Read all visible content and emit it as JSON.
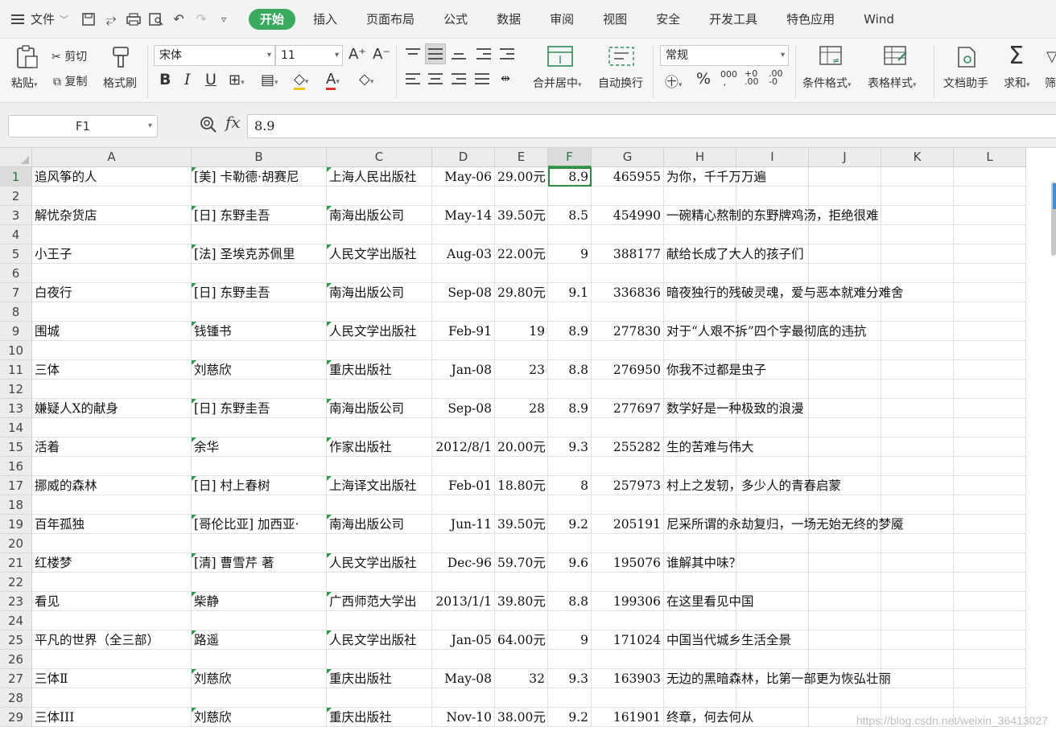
{
  "topbar": {
    "file_menu": "文件",
    "tabs": [
      {
        "label": "开始",
        "active": true
      },
      {
        "label": "插入"
      },
      {
        "label": "页面布局"
      },
      {
        "label": "公式"
      },
      {
        "label": "数据"
      },
      {
        "label": "审阅"
      },
      {
        "label": "视图"
      },
      {
        "label": "安全"
      },
      {
        "label": "开发工具"
      },
      {
        "label": "特色应用"
      },
      {
        "label": "Wind"
      }
    ],
    "accent": "#3aaa5e"
  },
  "ribbon": {
    "paste": "粘贴",
    "cut": "剪切",
    "copy": "复制",
    "format_painter": "格式刷",
    "font_name": "宋体",
    "font_size": "11",
    "bold": "B",
    "italic": "I",
    "underline": "U",
    "merge_center": "合并居中",
    "wrap_text": "自动换行",
    "number_format": "常规",
    "conditional_format": "条件格式",
    "table_style": "表格样式",
    "doc_assistant": "文档助手",
    "sum": "求和",
    "filter": "筛"
  },
  "formula_bar": {
    "name_box": "F1",
    "fx": "fx",
    "value": "8.9"
  },
  "columns": [
    "A",
    "B",
    "C",
    "D",
    "E",
    "F",
    "G",
    "H",
    "I",
    "J",
    "K",
    "L"
  ],
  "selected_cell": "F1",
  "rows": [
    {
      "n": "1",
      "A": "追风筝的人",
      "B": "[美] 卡勒德·胡赛尼",
      "C": "上海人民出版社",
      "D": "May-06",
      "E": "29.00元",
      "F": "8.9",
      "G": "465955",
      "H": "为你，千千万万遍"
    },
    {
      "n": "2"
    },
    {
      "n": "3",
      "A": "解忧杂货店",
      "B": "[日] 东野圭吾",
      "C": "南海出版公司",
      "D": "May-14",
      "E": "39.50元",
      "F": "8.5",
      "G": "454990",
      "H": "一碗精心熬制的东野牌鸡汤，拒绝很难"
    },
    {
      "n": "4"
    },
    {
      "n": "5",
      "A": "小王子",
      "B": "[法] 圣埃克苏佩里",
      "C": "人民文学出版社",
      "D": "Aug-03",
      "E": "22.00元",
      "F": "9",
      "G": "388177",
      "H": "献给长成了大人的孩子们"
    },
    {
      "n": "6"
    },
    {
      "n": "7",
      "A": "白夜行",
      "B": "[日] 东野圭吾",
      "C": "南海出版公司",
      "D": "Sep-08",
      "E": "29.80元",
      "F": "9.1",
      "G": "336836",
      "H": "暗夜独行的残破灵魂，爱与恶本就难分难舍"
    },
    {
      "n": "8"
    },
    {
      "n": "9",
      "A": "围城",
      "B": "钱锺书",
      "C": "人民文学出版社",
      "D": "Feb-91",
      "E": "19",
      "F": "8.9",
      "G": "277830",
      "H": "对于“人艰不拆”四个字最彻底的违抗"
    },
    {
      "n": "10"
    },
    {
      "n": "11",
      "A": "三体",
      "B": "刘慈欣",
      "C": "重庆出版社",
      "D": "Jan-08",
      "E": "23",
      "F": "8.8",
      "G": "276950",
      "H": "你我不过都是虫子"
    },
    {
      "n": "12"
    },
    {
      "n": "13",
      "A": "嫌疑人X的献身",
      "B": "[日] 东野圭吾",
      "C": "南海出版公司",
      "D": "Sep-08",
      "E": "28",
      "F": "8.9",
      "G": "277697",
      "H": "数学好是一种极致的浪漫"
    },
    {
      "n": "14"
    },
    {
      "n": "15",
      "A": "活着",
      "B": "余华",
      "C": "作家出版社",
      "D": "2012/8/1",
      "E": "20.00元",
      "F": "9.3",
      "G": "255282",
      "H": "生的苦难与伟大"
    },
    {
      "n": "16"
    },
    {
      "n": "17",
      "A": "挪威的森林",
      "B": "[日] 村上春树",
      "C": "上海译文出版社",
      "D": "Feb-01",
      "E": "18.80元",
      "F": "8",
      "G": "257973",
      "H": "村上之发轫，多少人的青春启蒙"
    },
    {
      "n": "18"
    },
    {
      "n": "19",
      "A": "百年孤独",
      "B": "[哥伦比亚] 加西亚·",
      "C": "南海出版公司",
      "D": "Jun-11",
      "E": "39.50元",
      "F": "9.2",
      "G": "205191",
      "H": "尼采所谓的永劫复归，一场无始无终的梦魇"
    },
    {
      "n": "20"
    },
    {
      "n": "21",
      "A": "红楼梦",
      "B": "[清] 曹雪芹 著",
      "C": "人民文学出版社",
      "D": "Dec-96",
      "E": "59.70元",
      "F": "9.6",
      "G": "195076",
      "H": "谁解其中味？"
    },
    {
      "n": "22"
    },
    {
      "n": "23",
      "A": "看见",
      "B": "柴静",
      "C": "广西师范大学出",
      "D": "2013/1/1",
      "E": "39.80元",
      "F": "8.8",
      "G": "199306",
      "H": "在这里看见中国"
    },
    {
      "n": "24"
    },
    {
      "n": "25",
      "A": "平凡的世界（全三部）",
      "B": "路遥",
      "C": "人民文学出版社",
      "D": "Jan-05",
      "E": "64.00元",
      "F": "9",
      "G": "171024",
      "H": "中国当代城乡生活全景"
    },
    {
      "n": "26"
    },
    {
      "n": "27",
      "A": "三体Ⅱ",
      "B": "刘慈欣",
      "C": "重庆出版社",
      "D": "May-08",
      "E": "32",
      "F": "9.3",
      "G": "163903",
      "H": "无边的黑暗森林，比第一部更为恢弘壮丽"
    },
    {
      "n": "28"
    },
    {
      "n": "29",
      "A": "三体III",
      "B": "刘慈欣",
      "C": "重庆出版社",
      "D": "Nov-10",
      "E": "38.00元",
      "F": "9.2",
      "G": "161901",
      "H": "终章，何去何从"
    }
  ],
  "watermark": "https://blog.csdn.net/weixin_36413027"
}
